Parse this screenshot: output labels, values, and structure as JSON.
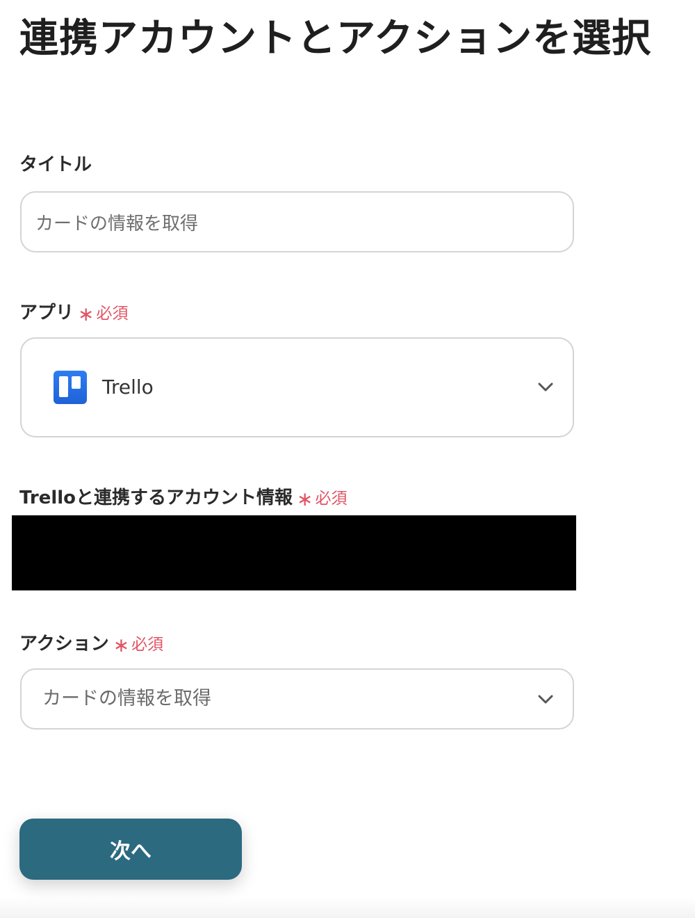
{
  "page": {
    "title": "連携アカウントとアクションを選択"
  },
  "form": {
    "title_field": {
      "label": "タイトル",
      "value": "カードの情報を取得"
    },
    "app_field": {
      "label": "アプリ",
      "required_mark": "∗",
      "required_text": "必須",
      "selected_app": "Trello",
      "app_icon": "trello-logo-icon",
      "dropdown_icon": "chevron-down-icon"
    },
    "account_field": {
      "label": "Trelloと連携するアカウント情報",
      "required_mark": "∗",
      "required_text": "必須"
    },
    "action_field": {
      "label": "アクション",
      "required_mark": "∗",
      "required_text": "必須",
      "selected_action": "カードの情報を取得",
      "dropdown_icon": "chevron-down-icon"
    }
  },
  "footer": {
    "next_label": "次へ"
  },
  "colors": {
    "required": "#e05565",
    "button": "#2c6a80",
    "trello": "#1f62d6"
  }
}
